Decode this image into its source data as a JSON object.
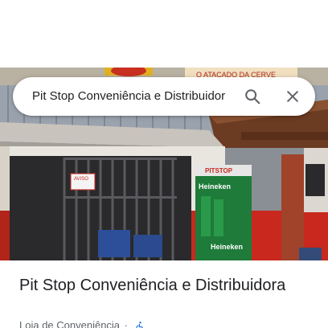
{
  "search": {
    "query": "Pit Stop Conveniência e Distribuidor",
    "search_icon": "search-icon",
    "clear_icon": "close-icon"
  },
  "photo": {
    "description_icon": "storefront-photo",
    "store_sign_left": "O ATACADO DA CERVE",
    "aviso_sign": "AVISO",
    "poster_brand": "PITSTOP",
    "poster_beer_1": "Heineken",
    "poster_beer_2": "Heineken"
  },
  "place": {
    "name": "Pit Stop Conveniência e Distribuidora",
    "category": "Loja de Conveniência",
    "separator": "·",
    "accessibility_icon": "wheelchair-icon"
  },
  "colors": {
    "accent_blue": "#1a73e8",
    "text_primary": "#202124",
    "text_secondary": "#5f6368",
    "heineken_green": "#1e7b3a",
    "store_red": "#c8281e"
  }
}
